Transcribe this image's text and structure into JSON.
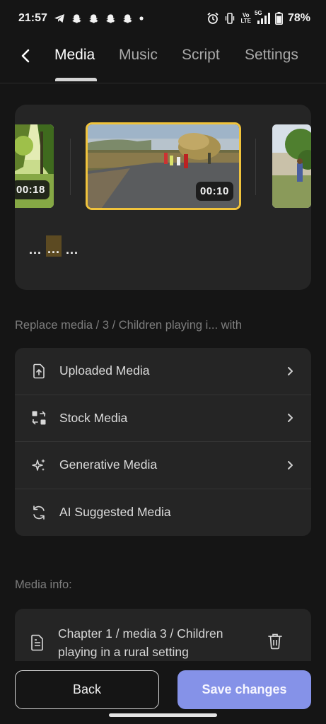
{
  "status_bar": {
    "time": "21:57",
    "network_vo": "Vo",
    "network_lte": "LTE",
    "network_5g": "5G",
    "battery": "78%",
    "icons": [
      "telegram-icon",
      "snapchat-icon",
      "snapchat-icon",
      "snapchat-icon",
      "snapchat-icon",
      "dot-icon",
      "alarm-icon",
      "vibrate-icon",
      "signal-icon",
      "battery-icon"
    ]
  },
  "nav": {
    "tabs": [
      {
        "label": "Media",
        "active": true
      },
      {
        "label": "Music",
        "active": false
      },
      {
        "label": "Script",
        "active": false
      },
      {
        "label": "Settings",
        "active": false
      }
    ]
  },
  "timeline": {
    "clips": [
      {
        "duration": "00:18",
        "selected": false
      },
      {
        "duration": "00:10",
        "selected": true
      },
      {
        "duration": "",
        "selected": false
      }
    ],
    "tokens": [
      "...",
      "...",
      "..."
    ]
  },
  "replace": {
    "label": "Replace media / 3 / Children playing i... with",
    "options": [
      {
        "label": "Uploaded Media",
        "icon": "upload-file-icon",
        "chevron": true
      },
      {
        "label": "Stock Media",
        "icon": "swap-icon",
        "chevron": true
      },
      {
        "label": "Generative Media",
        "icon": "sparkles-icon",
        "chevron": true
      },
      {
        "label": "AI Suggested Media",
        "icon": "refresh-icon",
        "chevron": false
      }
    ]
  },
  "media_info": {
    "label": "Media info:",
    "line1": "Chapter 1 / media 3 / Children",
    "line2": "playing in a rural setting"
  },
  "footer": {
    "back_label": "Back",
    "save_label": "Save changes"
  },
  "colors": {
    "accent": "#8592e8",
    "selection": "#f0c33c",
    "background": "#151515",
    "card": "#252525"
  }
}
